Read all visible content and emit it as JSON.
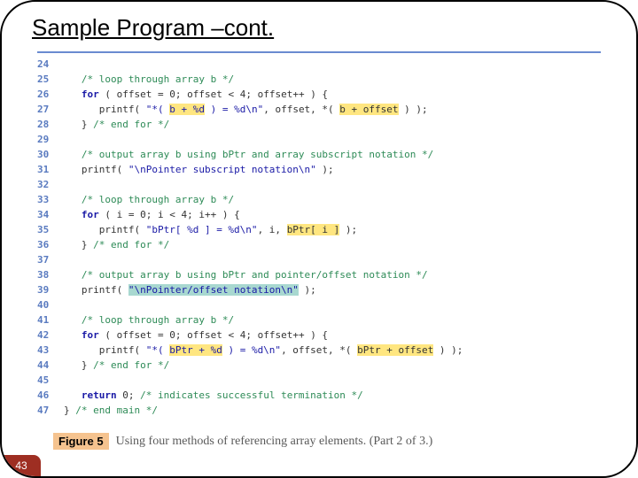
{
  "title": "Sample Program –cont.",
  "page_number": "43",
  "figure": {
    "label": "Figure 5",
    "caption": "Using four methods of referencing array elements. (Part 2 of 3.)"
  },
  "code": {
    "lines": [
      {
        "n": "24",
        "segs": []
      },
      {
        "n": "25",
        "segs": [
          {
            "t": "   "
          },
          {
            "t": "/* loop through array b */",
            "c": "cm"
          }
        ]
      },
      {
        "n": "26",
        "segs": [
          {
            "t": "   "
          },
          {
            "t": "for",
            "c": "kw"
          },
          {
            "t": " ( offset = "
          },
          {
            "t": "0",
            "c": "num"
          },
          {
            "t": "; offset < "
          },
          {
            "t": "4",
            "c": "num"
          },
          {
            "t": "; offset++ ) {"
          }
        ]
      },
      {
        "n": "27",
        "segs": [
          {
            "t": "      printf( "
          },
          {
            "t": "\"*( ",
            "c": "str"
          },
          {
            "t": "b + %d",
            "c": "str hl"
          },
          {
            "t": " ) = %d\\n\"",
            "c": "str"
          },
          {
            "t": ", offset, *( "
          },
          {
            "t": "b + offset",
            "c": "hl"
          },
          {
            "t": " ) );"
          }
        ]
      },
      {
        "n": "28",
        "segs": [
          {
            "t": "   } "
          },
          {
            "t": "/* end for */",
            "c": "cm"
          }
        ]
      },
      {
        "n": "29",
        "segs": []
      },
      {
        "n": "30",
        "segs": [
          {
            "t": "   "
          },
          {
            "t": "/* output array b using bPtr and array subscript notation */",
            "c": "cm"
          }
        ]
      },
      {
        "n": "31",
        "segs": [
          {
            "t": "   printf( "
          },
          {
            "t": "\"\\nPointer subscript notation\\n\"",
            "c": "str"
          },
          {
            "t": " );"
          }
        ]
      },
      {
        "n": "32",
        "segs": []
      },
      {
        "n": "33",
        "segs": [
          {
            "t": "   "
          },
          {
            "t": "/* loop through array b */",
            "c": "cm"
          }
        ]
      },
      {
        "n": "34",
        "segs": [
          {
            "t": "   "
          },
          {
            "t": "for",
            "c": "kw"
          },
          {
            "t": " ( i = "
          },
          {
            "t": "0",
            "c": "num"
          },
          {
            "t": "; i < "
          },
          {
            "t": "4",
            "c": "num"
          },
          {
            "t": "; i++ ) {"
          }
        ]
      },
      {
        "n": "35",
        "segs": [
          {
            "t": "      printf( "
          },
          {
            "t": "\"bPtr[ %d ] = %d\\n\"",
            "c": "str"
          },
          {
            "t": ", i, "
          },
          {
            "t": "bPtr[ i ]",
            "c": "hl"
          },
          {
            "t": " );"
          }
        ]
      },
      {
        "n": "36",
        "segs": [
          {
            "t": "   } "
          },
          {
            "t": "/* end for */",
            "c": "cm"
          }
        ]
      },
      {
        "n": "37",
        "segs": []
      },
      {
        "n": "38",
        "segs": [
          {
            "t": "   "
          },
          {
            "t": "/* output array b using bPtr and pointer/offset notation */",
            "c": "cm"
          }
        ]
      },
      {
        "n": "39",
        "segs": [
          {
            "t": "   printf( "
          },
          {
            "t": "\"\\nPointer/offset notation\\n\"",
            "c": "str hl-teal"
          },
          {
            "t": " );"
          }
        ]
      },
      {
        "n": "40",
        "segs": []
      },
      {
        "n": "41",
        "segs": [
          {
            "t": "   "
          },
          {
            "t": "/* loop through array b */",
            "c": "cm"
          }
        ]
      },
      {
        "n": "42",
        "segs": [
          {
            "t": "   "
          },
          {
            "t": "for",
            "c": "kw"
          },
          {
            "t": " ( offset = "
          },
          {
            "t": "0",
            "c": "num"
          },
          {
            "t": "; offset < "
          },
          {
            "t": "4",
            "c": "num"
          },
          {
            "t": "; offset++ ) {"
          }
        ]
      },
      {
        "n": "43",
        "segs": [
          {
            "t": "      printf( "
          },
          {
            "t": "\"*( ",
            "c": "str"
          },
          {
            "t": "bPtr + %d",
            "c": "str hl"
          },
          {
            "t": " ) = %d\\n\"",
            "c": "str"
          },
          {
            "t": ", offset, *( "
          },
          {
            "t": "bPtr + offset",
            "c": "hl"
          },
          {
            "t": " ) );"
          }
        ]
      },
      {
        "n": "44",
        "segs": [
          {
            "t": "   } "
          },
          {
            "t": "/* end for */",
            "c": "cm"
          }
        ]
      },
      {
        "n": "45",
        "segs": []
      },
      {
        "n": "46",
        "segs": [
          {
            "t": "   "
          },
          {
            "t": "return",
            "c": "kw"
          },
          {
            "t": " "
          },
          {
            "t": "0",
            "c": "num"
          },
          {
            "t": "; "
          },
          {
            "t": "/* indicates successful termination */",
            "c": "cm"
          }
        ]
      },
      {
        "n": "47",
        "segs": [
          {
            "t": "} "
          },
          {
            "t": "/* end main */",
            "c": "cm"
          }
        ]
      }
    ]
  }
}
